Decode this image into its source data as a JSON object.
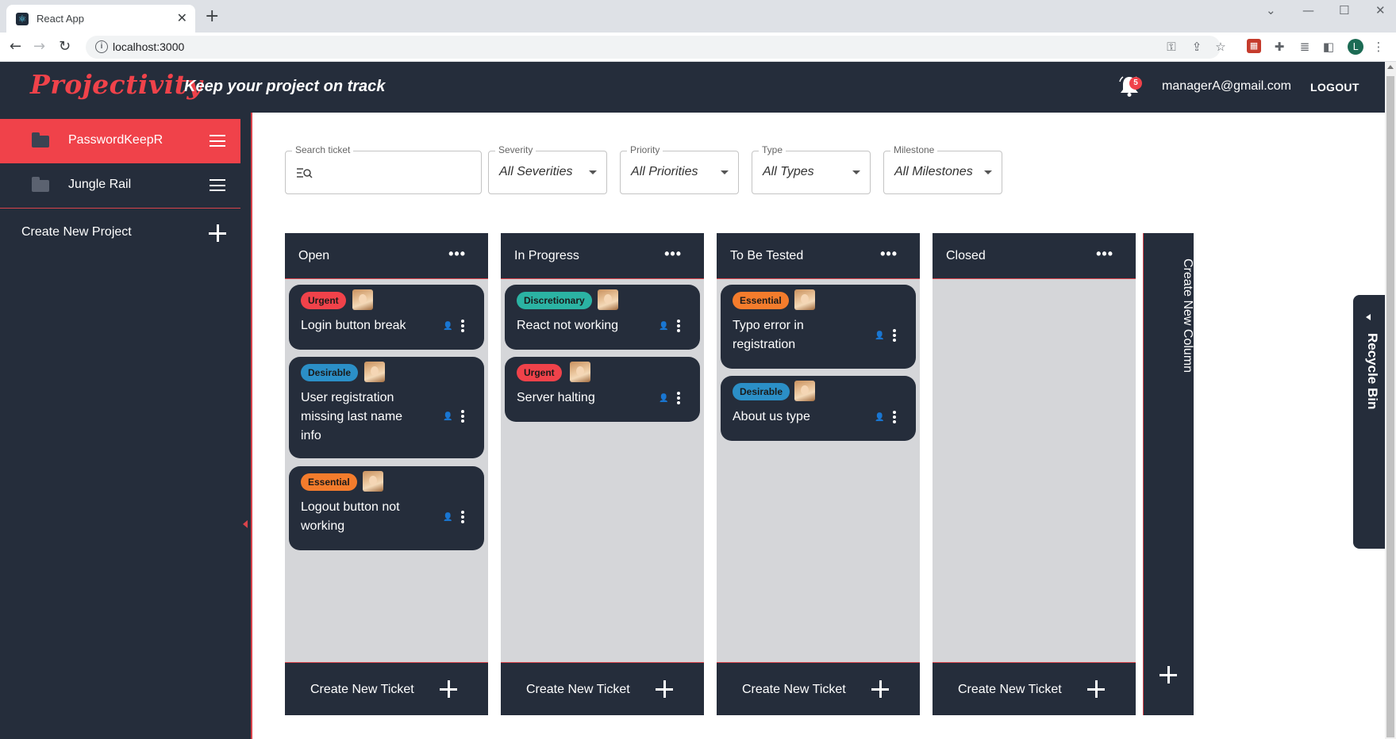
{
  "browser": {
    "tab_title": "React App",
    "favicon": "react-logo-icon",
    "url": "localhost:3000",
    "profile_initial": "L"
  },
  "header": {
    "brand": "Projectivity",
    "tagline": "Keep your project on track",
    "notification_count": "5",
    "user_email": "managerA@gmail.com",
    "logout_label": "LOGOUT"
  },
  "sidebar": {
    "projects": [
      {
        "label": "PasswordKeepR",
        "active": true
      },
      {
        "label": "Jungle Rail",
        "active": false
      }
    ],
    "create_label": "Create New Project"
  },
  "filters": {
    "search": {
      "label": "Search ticket",
      "value": ""
    },
    "severity": {
      "label": "Severity",
      "value": "All Severities"
    },
    "priority": {
      "label": "Priority",
      "value": "All Priorities"
    },
    "type": {
      "label": "Type",
      "value": "All Types"
    },
    "milestone": {
      "label": "Milestone",
      "value": "All Milestones"
    }
  },
  "badge_colors": {
    "Urgent": "#f0424a",
    "Desirable": "#2b8fc7",
    "Essential": "#f47c2c",
    "Discretionary": "#2bb3a3"
  },
  "columns": [
    {
      "title": "Open",
      "footer": "Create New Ticket",
      "tickets": [
        {
          "badge": "Urgent",
          "title": "Login button break"
        },
        {
          "badge": "Desirable",
          "title": "User registration missing last name info"
        },
        {
          "badge": "Essential",
          "title": "Logout button not working"
        }
      ]
    },
    {
      "title": "In Progress",
      "footer": "Create New Ticket",
      "tickets": [
        {
          "badge": "Discretionary",
          "title": "React not working"
        },
        {
          "badge": "Urgent",
          "title": "Server halting"
        }
      ]
    },
    {
      "title": "To Be Tested",
      "footer": "Create New Ticket",
      "tickets": [
        {
          "badge": "Essential",
          "title": "Typo error in registration"
        },
        {
          "badge": "Desirable",
          "title": "About us type"
        }
      ]
    },
    {
      "title": "Closed",
      "footer": "Create New Ticket",
      "tickets": []
    }
  ],
  "new_column_label": "Create New Column",
  "recycle_bin_label": "Recycle Bin"
}
